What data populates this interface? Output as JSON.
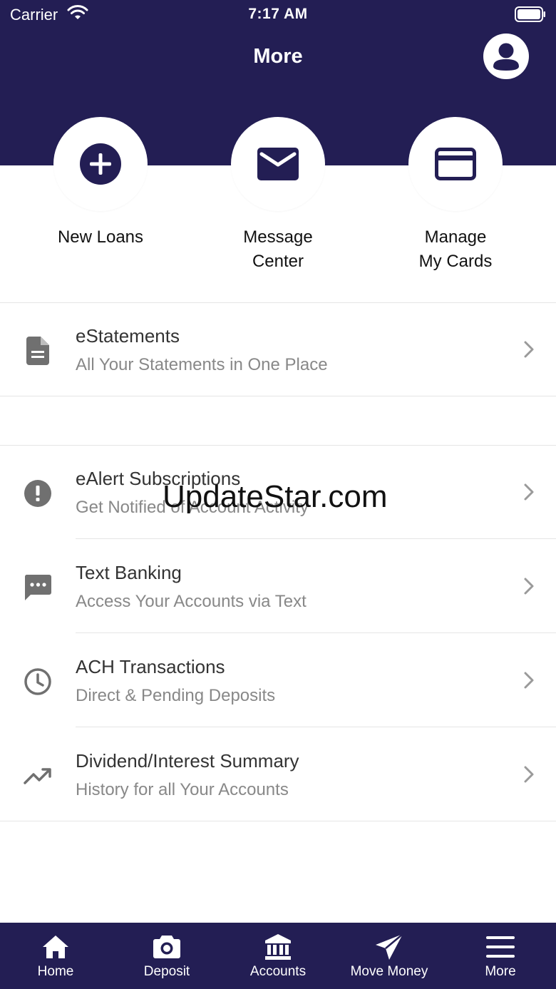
{
  "status_bar": {
    "carrier": "Carrier",
    "time": "7:17 AM"
  },
  "header": {
    "title": "More"
  },
  "quick_actions": [
    {
      "line1": "New Loans",
      "line2": ""
    },
    {
      "line1": "Message",
      "line2": "Center"
    },
    {
      "line1": "Manage",
      "line2": "My Cards"
    }
  ],
  "menu": [
    {
      "title": "eStatements",
      "subtitle": "All Your Statements in One Place",
      "icon": "document-icon"
    },
    {
      "title": "eAlert Subscriptions",
      "subtitle": "Get Notified of Account Activity",
      "icon": "alert-icon"
    },
    {
      "title": "Text Banking",
      "subtitle": "Access Your Accounts via Text",
      "icon": "chat-icon"
    },
    {
      "title": "ACH Transactions",
      "subtitle": "Direct & Pending Deposits",
      "icon": "clock-icon"
    },
    {
      "title": "Dividend/Interest Summary",
      "subtitle": "History for all Your Accounts",
      "icon": "trending-up-icon"
    }
  ],
  "watermark": "UpdateStar.com",
  "tabs": [
    {
      "label": "Home",
      "icon": "home-icon"
    },
    {
      "label": "Deposit",
      "icon": "camera-icon"
    },
    {
      "label": "Accounts",
      "icon": "bank-icon"
    },
    {
      "label": "Move Money",
      "icon": "send-icon"
    },
    {
      "label": "More",
      "icon": "menu-icon"
    }
  ],
  "colors": {
    "brand": "#231e54",
    "text_secondary": "#888888",
    "icon_gray": "#707070"
  }
}
